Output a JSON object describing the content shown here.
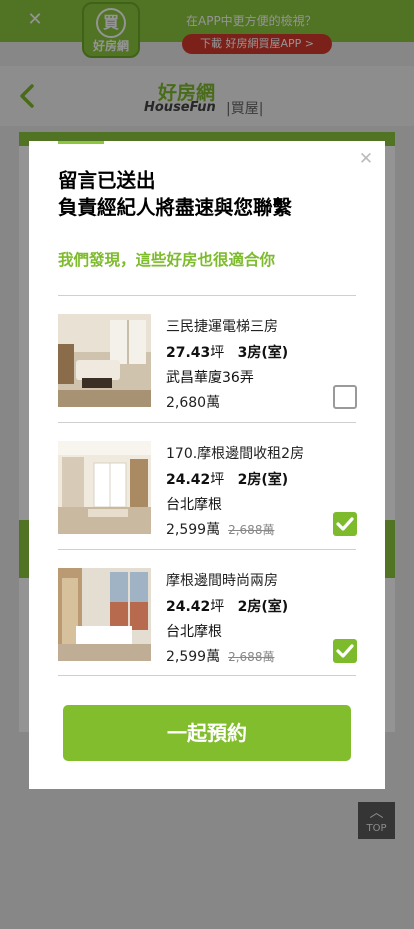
{
  "app_banner": {
    "logo_glyph": "買",
    "logo_text": "好房網",
    "message": "在APP中更方便的檢視？",
    "download_label": "下載 好房網買屋APP >",
    "close_icon": "close-icon",
    "color": "#8cc63f"
  },
  "header": {
    "back_icon": "chevron-left-icon",
    "brand_zh": "好房網",
    "brand_en": "HouseFun",
    "brand_tag": "|買屋|"
  },
  "back_to_top": {
    "label": "TOP",
    "icon": "chevron-up-icon"
  },
  "modal": {
    "close_icon": "close-icon",
    "title_line1": "留言已送出",
    "title_line2": "負責經紀人將盡速與您聯繫",
    "subtitle": "我們發現，這些好房也很適合你",
    "accent_color": "#7dbb2c",
    "listings": [
      {
        "title": "三民捷運電梯三房",
        "size": "27.43",
        "size_unit": "坪",
        "rooms": "3房(室)",
        "area": "武昌華廈36弄",
        "price": "2,680萬",
        "old_price": "",
        "checked": false
      },
      {
        "title": "170.摩根邊間收租2房",
        "size": "24.42",
        "size_unit": "坪",
        "rooms": "2房(室)",
        "area": "台北摩根",
        "price": "2,599萬",
        "old_price": "2,688萬",
        "checked": true
      },
      {
        "title": "摩根邊間時尚兩房",
        "size": "24.42",
        "size_unit": "坪",
        "rooms": "2房(室)",
        "area": "台北摩根",
        "price": "2,599萬",
        "old_price": "2,688萬",
        "checked": true
      }
    ],
    "submit_label": "一起預約"
  }
}
